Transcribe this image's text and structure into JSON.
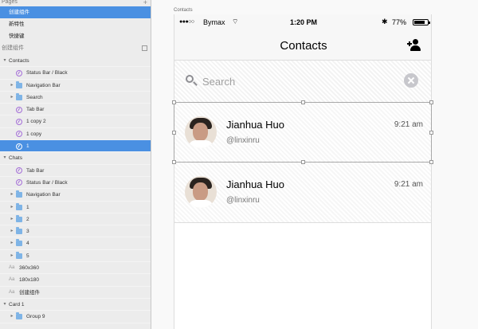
{
  "panel": {
    "pages_header": "Pages",
    "pages": [
      {
        "label": "创建组件",
        "selected": true
      },
      {
        "label": "新特性",
        "selected": false
      },
      {
        "label": "快捷键",
        "selected": false
      }
    ],
    "layers_header": "创建组件",
    "layers": [
      {
        "label": "Contacts",
        "kind": "group",
        "depth": 0,
        "open": true
      },
      {
        "label": "Status Bar / Black",
        "kind": "symbol",
        "depth": 1
      },
      {
        "label": "Navigation Bar",
        "kind": "folder",
        "depth": 1
      },
      {
        "label": "Search",
        "kind": "folder",
        "depth": 1
      },
      {
        "label": "Tab Bar",
        "kind": "symbol",
        "depth": 1
      },
      {
        "label": "1 copy 2",
        "kind": "symbol",
        "depth": 1
      },
      {
        "label": "1 copy",
        "kind": "symbol",
        "depth": 1
      },
      {
        "label": "1",
        "kind": "symbol",
        "depth": 1,
        "selected": true
      },
      {
        "label": "Chats",
        "kind": "group",
        "depth": 0,
        "open": true
      },
      {
        "label": "Tab Bar",
        "kind": "symbol",
        "depth": 1
      },
      {
        "label": "Status Bar / Black",
        "kind": "symbol",
        "depth": 1
      },
      {
        "label": "Navigation Bar",
        "kind": "folder",
        "depth": 1
      },
      {
        "label": "1",
        "kind": "folder",
        "depth": 1
      },
      {
        "label": "2",
        "kind": "folder",
        "depth": 1
      },
      {
        "label": "3",
        "kind": "folder",
        "depth": 1
      },
      {
        "label": "4",
        "kind": "folder",
        "depth": 1
      },
      {
        "label": "5",
        "kind": "folder",
        "depth": 1
      },
      {
        "label": "360x360",
        "kind": "text",
        "depth": 0
      },
      {
        "label": "180x180",
        "kind": "text",
        "depth": 0
      },
      {
        "label": "创建组件",
        "kind": "text",
        "depth": 0
      },
      {
        "label": "Card 1",
        "kind": "group",
        "depth": 0,
        "open": true
      },
      {
        "label": "Group 9",
        "kind": "folder",
        "depth": 1
      }
    ]
  },
  "canvas": {
    "artboard_label": "Contacts",
    "status": {
      "carrier": "Bymax",
      "time": "1:20 PM",
      "battery": "77%"
    },
    "nav": {
      "title": "Contacts"
    },
    "search": {
      "placeholder": "Search"
    },
    "contacts": [
      {
        "name": "Jianhua Huo",
        "handle": "@linxinru",
        "time": "9:21 am"
      },
      {
        "name": "Jianhua Huo",
        "handle": "@linxinru",
        "time": "9:21 am"
      }
    ]
  },
  "colors": {
    "selection": "#4a90e2",
    "panel_bg": "#ececec",
    "folder": "#7fb4e6",
    "symbol": "#a56fd8"
  }
}
